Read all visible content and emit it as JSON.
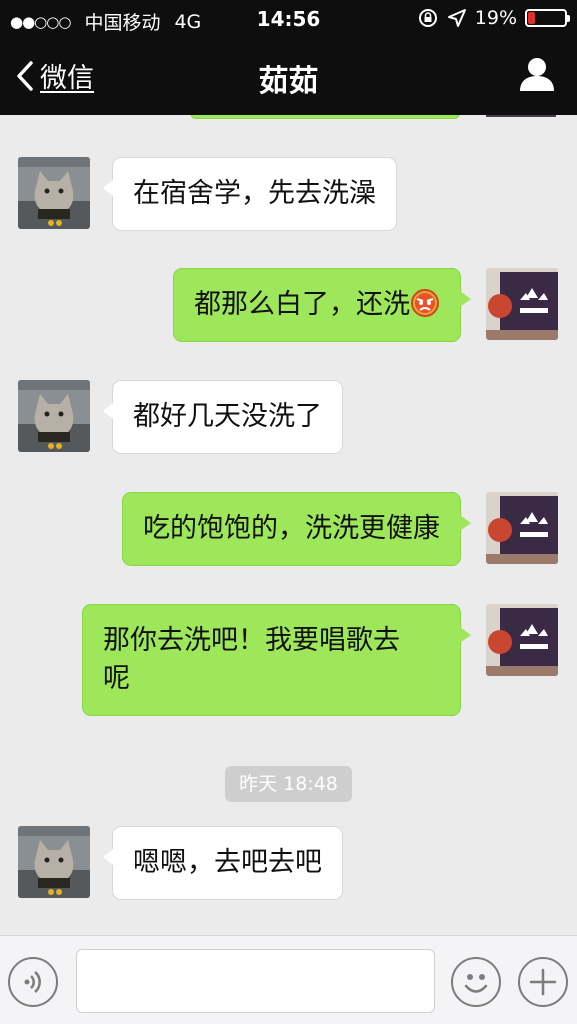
{
  "status_bar": {
    "carrier": "中国移动",
    "network": "4G",
    "time": "14:56",
    "battery": "19%",
    "battery_level": 0.19,
    "battery_color": "#e0302a"
  },
  "nav": {
    "back_label": "微信",
    "title": "茹茹"
  },
  "messages": [
    {
      "side": "left",
      "text": "在宿舍学，先去洗澡"
    },
    {
      "side": "right",
      "text": "都那么白了，还洗",
      "emoji": "angry-face"
    },
    {
      "side": "left",
      "text": "都好几天没洗了"
    },
    {
      "side": "right",
      "text": "吃的饱饱的，洗洗更健康"
    },
    {
      "side": "right",
      "line1": "那你去洗吧！我要唱歌去",
      "line2": "呢"
    },
    {
      "side": "left",
      "text": "嗯嗯，去吧去吧"
    }
  ],
  "timestamp": "昨天 18:48",
  "input": {
    "value": "",
    "placeholder": ""
  },
  "colors": {
    "bar_background": "#0e0e0e",
    "chat_background": "#ebebeb",
    "my_bubble": "#9fe75a",
    "friend_bubble": "#ffffff"
  }
}
